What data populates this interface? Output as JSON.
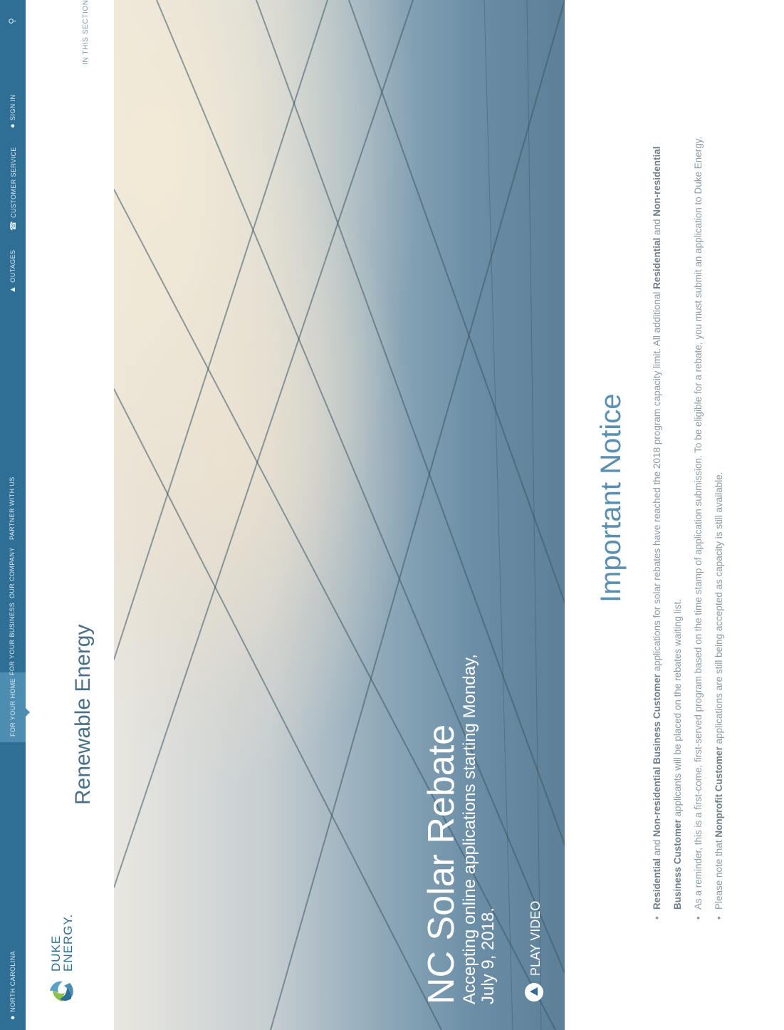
{
  "topbar": {
    "state": "NORTH CAROLINA",
    "nav": [
      "FOR YOUR HOME",
      "FOR YOUR BUSINESS",
      "OUR COMPANY",
      "PARTNER WITH US"
    ],
    "utility": {
      "outages": "OUTAGES",
      "customer_service": "CUSTOMER SERVICE",
      "sign_in": "SIGN IN"
    }
  },
  "logo": {
    "line1": "DUKE",
    "line2": "ENERGY."
  },
  "section_title": "Renewable Energy",
  "in_this_section": "IN THIS SECTION ⌄",
  "hero": {
    "title": "NC Solar Rebate",
    "subtitle": "Accepting online applications starting Monday, July 9, 2018.",
    "play_label": "PLAY VIDEO"
  },
  "notice": {
    "title": "Important Notice",
    "items": [
      {
        "b1": "Residential",
        "t1": " and ",
        "b2": "Non-residential Business Customer",
        "t2": " applications for solar rebates have reached the 2018 program capacity limit. All additional ",
        "b3": "Residential",
        "t3": " and ",
        "b4": "Non-residential Business Customer",
        "t4": " applicants will be placed on the rebates waiting list."
      },
      {
        "t1": "As a reminder, this is a first-come, first-served program based on the time stamp of application submission. To be eligible for a rebate, you must submit an application to Duke Energy."
      },
      {
        "t1": "Please note that ",
        "b1": "Nonprofit Customer",
        "t2": " applications are still being accepted as capacity is still available."
      }
    ]
  },
  "colors": {
    "brand_blue": "#2f6f96",
    "active_nav": "#4d8db2",
    "notice_title": "#5a8fb0"
  }
}
